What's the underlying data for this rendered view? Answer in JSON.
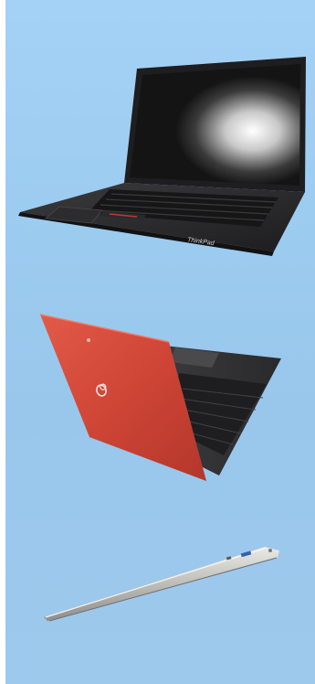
{
  "laptops": [
    {
      "id": "thinkpad",
      "brand_text": "ThinkPad",
      "color": "#2a2a2c"
    },
    {
      "id": "fujitsu",
      "brand_text": "",
      "color": "#d24a3a"
    },
    {
      "id": "macbook-air",
      "brand_text": "",
      "color": "#c9c9c6"
    }
  ]
}
